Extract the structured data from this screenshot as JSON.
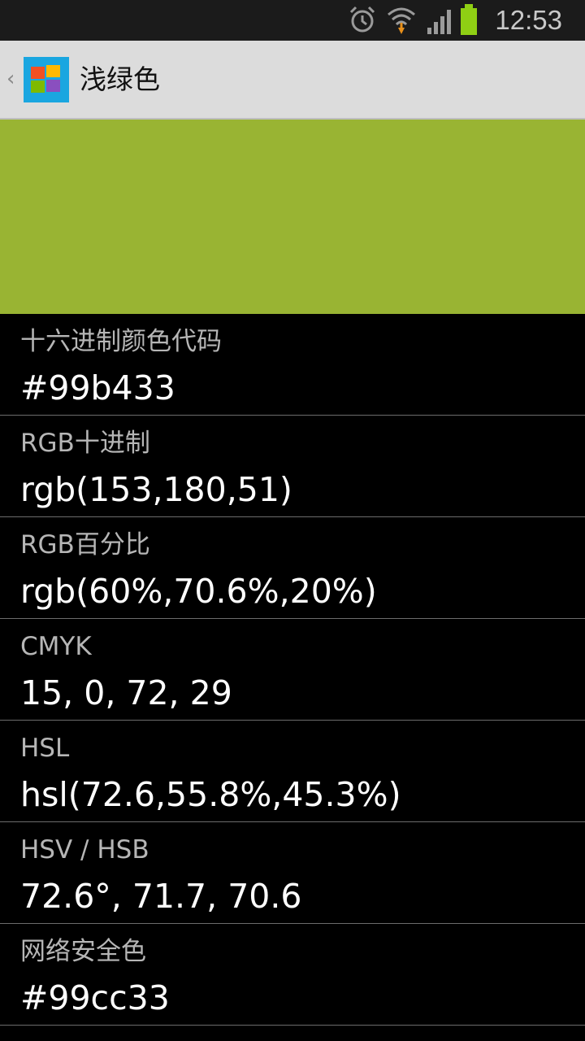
{
  "status_bar": {
    "time": "12:53",
    "icons": [
      "alarm-icon",
      "wifi-icon",
      "signal-icon",
      "battery-icon"
    ]
  },
  "action_bar": {
    "title": "浅绿色",
    "icon": "windows-logo-icon"
  },
  "swatch": {
    "color": "#99b433"
  },
  "rows": [
    {
      "label": "十六进制颜色代码",
      "value": "#99b433"
    },
    {
      "label": "RGB十进制",
      "value": "rgb(153,180,51)"
    },
    {
      "label": "RGB百分比",
      "value": "rgb(60%,70.6%,20%)"
    },
    {
      "label": "CMYK",
      "value": "15, 0, 72, 29"
    },
    {
      "label": "HSL",
      "value": "hsl(72.6,55.8%,45.3%)"
    },
    {
      "label": "HSV / HSB",
      "value": "72.6°, 71.7, 70.6"
    },
    {
      "label": "网络安全色",
      "value": "#99cc33"
    }
  ]
}
